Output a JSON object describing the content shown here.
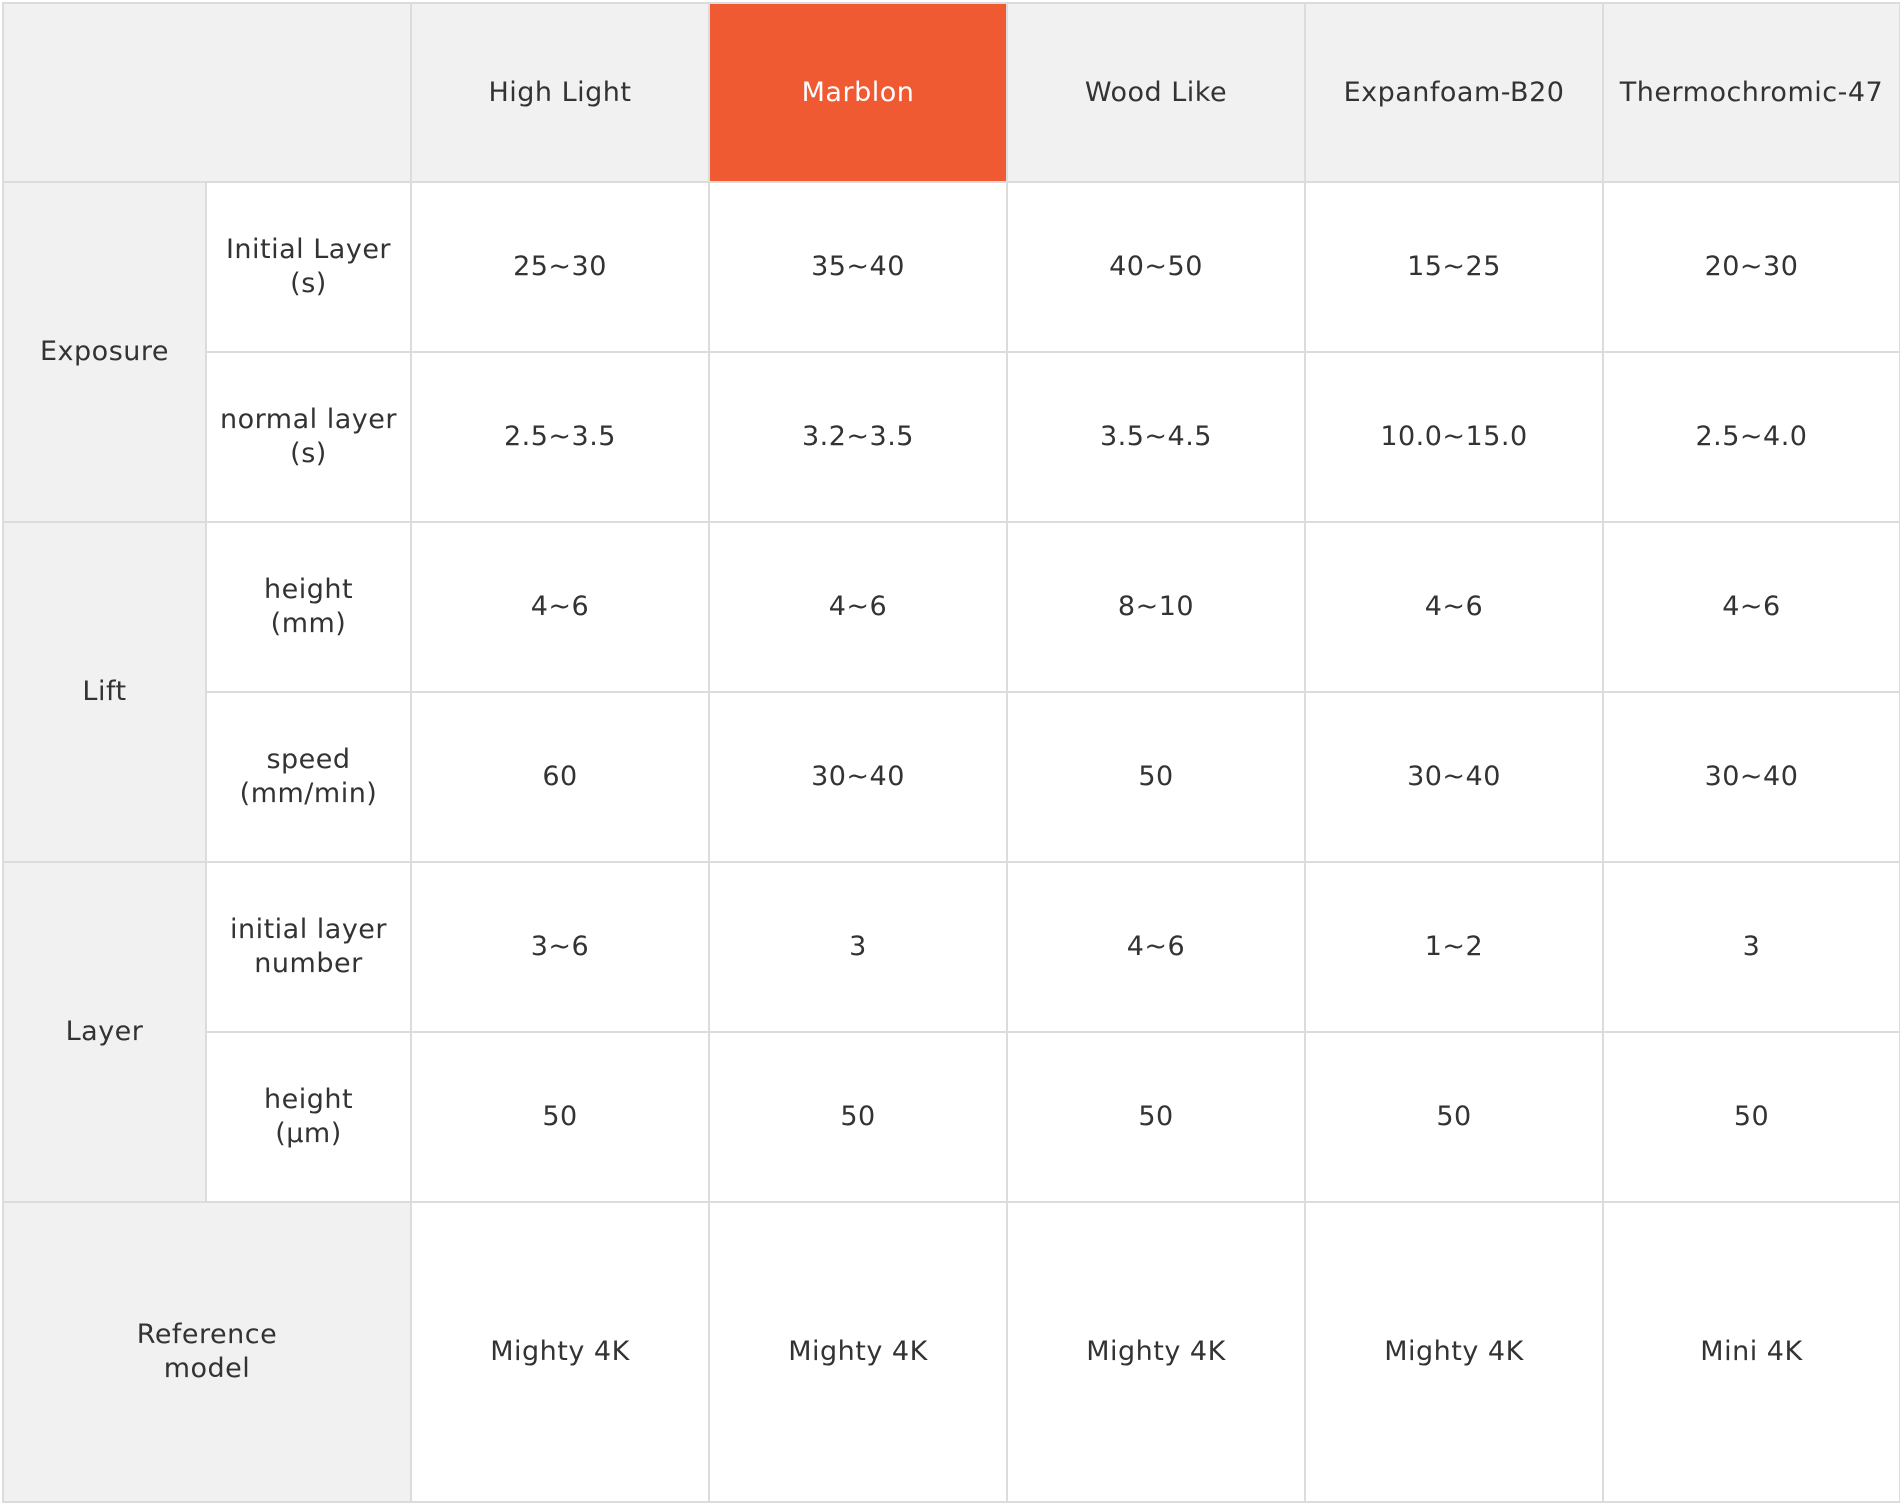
{
  "table": {
    "materials": [
      "High Light",
      "Marblon",
      "Wood Like",
      "Expanfoam-B20",
      "Thermochromic-47"
    ],
    "highlight_color": "#f05a33",
    "groups": [
      {
        "label": "Exposure",
        "rows": [
          {
            "param": "Initial Layer",
            "unit": "(s)",
            "values": [
              "25~30",
              "35~40",
              "40~50",
              "15~25",
              "20~30"
            ]
          },
          {
            "param": "normal layer",
            "unit": "(s)",
            "values": [
              "2.5~3.5",
              "3.2~3.5",
              "3.5~4.5",
              "10.0~15.0",
              "2.5~4.0"
            ]
          }
        ]
      },
      {
        "label": "Lift",
        "rows": [
          {
            "param": "height",
            "unit": "(mm)",
            "values": [
              "4~6",
              "4~6",
              "8~10",
              "4~6",
              "4~6"
            ]
          },
          {
            "param": "speed",
            "unit": "(mm/min)",
            "values": [
              "60",
              "30~40",
              "50",
              "30~40",
              "30~40"
            ]
          }
        ]
      },
      {
        "label": "Layer",
        "rows": [
          {
            "param": "initial layer",
            "unit": "number",
            "values": [
              "3~6",
              "3",
              "4~6",
              "1~2",
              "3"
            ]
          },
          {
            "param": "height",
            "unit": "(μm)",
            "values": [
              "50",
              "50",
              "50",
              "50",
              "50"
            ]
          }
        ]
      }
    ],
    "reference": {
      "label_line1": "Reference",
      "label_line2": "model",
      "values": [
        "Mighty 4K",
        "Mighty 4K",
        "Mighty 4K",
        "Mighty 4K",
        "Mini 4K"
      ]
    }
  }
}
